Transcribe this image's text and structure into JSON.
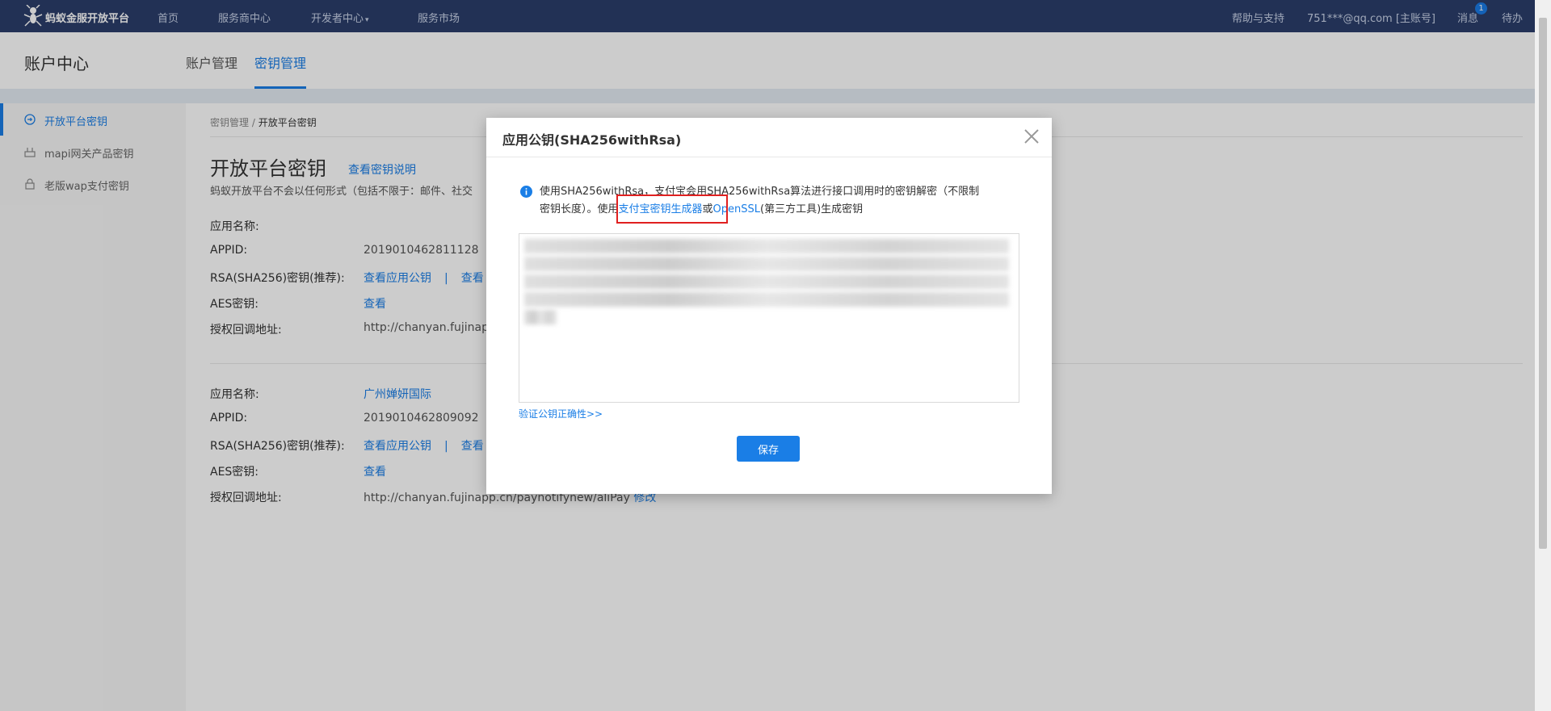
{
  "topnav": {
    "brand": "蚂蚁金服开放平台",
    "items": [
      "首页",
      "服务商中心",
      "开发者中心",
      "服务市场"
    ],
    "right": {
      "help": "帮助与支持",
      "account": "751***@qq.com [主账号]",
      "messages": "消息",
      "message_count": "1",
      "todo": "待办"
    }
  },
  "header": {
    "title": "账户中心",
    "tabs": [
      "账户管理",
      "密钥管理"
    ],
    "active_tab": "密钥管理"
  },
  "sidebar": {
    "items": [
      {
        "label": "开放平台密钥",
        "active": true
      },
      {
        "label": "mapi网关产品密钥",
        "active": false
      },
      {
        "label": "老版wap支付密钥",
        "active": false
      }
    ]
  },
  "main": {
    "breadcrumb": {
      "parent": "密钥管理",
      "sep": "/",
      "current": "开放平台密钥"
    },
    "title": "开放平台密钥",
    "doc_link": "查看密钥说明",
    "description": "蚂蚁开放平台不会以任何形式（包括不限于：邮件、社交",
    "apps": [
      {
        "name_label": "应用名称:",
        "name": "",
        "appid_label": "APPID:",
        "appid": "2019010462811128",
        "rsa_label": "RSA(SHA256)密钥(推荐):",
        "rsa_link": "查看应用公钥",
        "rsa_sep": "|",
        "rsa_link2": "查看",
        "aes_label": "AES密钥:",
        "aes_link": "查看",
        "callback_label": "授权回调地址:",
        "callback": "http://chanyan.fujinapp.c",
        "callback_edit": ""
      },
      {
        "name_label": "应用名称:",
        "name": "广州婵妍国际",
        "appid_label": "APPID:",
        "appid": "2019010462809092",
        "rsa_label": "RSA(SHA256)密钥(推荐):",
        "rsa_link": "查看应用公钥",
        "rsa_sep": "|",
        "rsa_link2": "查看",
        "aes_label": "AES密钥:",
        "aes_link": "查看",
        "callback_label": "授权回调地址:",
        "callback": "http://chanyan.fujinapp.cn/paynotifynew/aliPay",
        "callback_edit": "修改"
      }
    ]
  },
  "modal": {
    "title": "应用公钥(SHA256withRsa)",
    "info_line1": "使用SHA256withRsa，支付宝会用SHA256withRsa算法进行接口调用时的密钥解密（不限制",
    "info_line2_pre": "密钥长度）。使用",
    "info_link1": "支付宝密钥生成器",
    "info_mid": "或",
    "info_link2": "OpenSSL",
    "info_post": "(第三方工具)生成密钥",
    "verify_link": "验证公钥正确性>>",
    "save_label": "保存"
  },
  "colors": {
    "nav_bg": "#2b3e6b",
    "accent": "#1a7ee6",
    "highlight_box": "#e02020"
  }
}
